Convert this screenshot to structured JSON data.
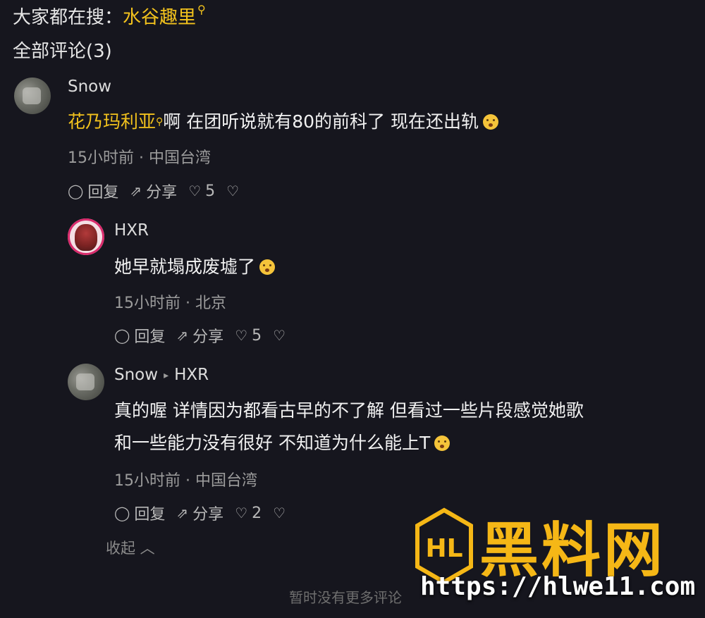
{
  "search": {
    "prefix": "大家都在搜：",
    "keyword": "水谷趣里",
    "search_icon": "magnifier-icon"
  },
  "comment_count_label": "全部评论(3)",
  "comments": [
    {
      "user": "Snow",
      "link_text": "花乃玛利亚",
      "text": "啊 在团听说就有80的前科了 现在还出轨",
      "meta": "15小时前 · 中国台湾",
      "reply": "回复",
      "share": "分享",
      "likes": "5"
    },
    {
      "user": "HXR",
      "text": "她早就塌成废墟了",
      "meta": "15小时前 · 北京",
      "reply": "回复",
      "share": "分享",
      "likes": "5"
    },
    {
      "user": "Snow",
      "reply_to": "HXR",
      "text_line1": "真的喔 详情因为都看古早的不了解 但看过一些片段感觉她歌",
      "text_line2": "和一些能力没有很好 不知道为什么能上T",
      "meta": "15小时前 · 中国台湾",
      "reply": "回复",
      "share": "分享",
      "likes": "2"
    }
  ],
  "collapse_label": "收起",
  "no_more_label": "暂时没有更多评论",
  "watermark": {
    "title": "黑料网",
    "url": "https://hlwe11.com",
    "logo_text": "HL"
  },
  "colors": {
    "background": "#16161e",
    "accent": "#f2c21d",
    "watermark": "#f5b716"
  }
}
